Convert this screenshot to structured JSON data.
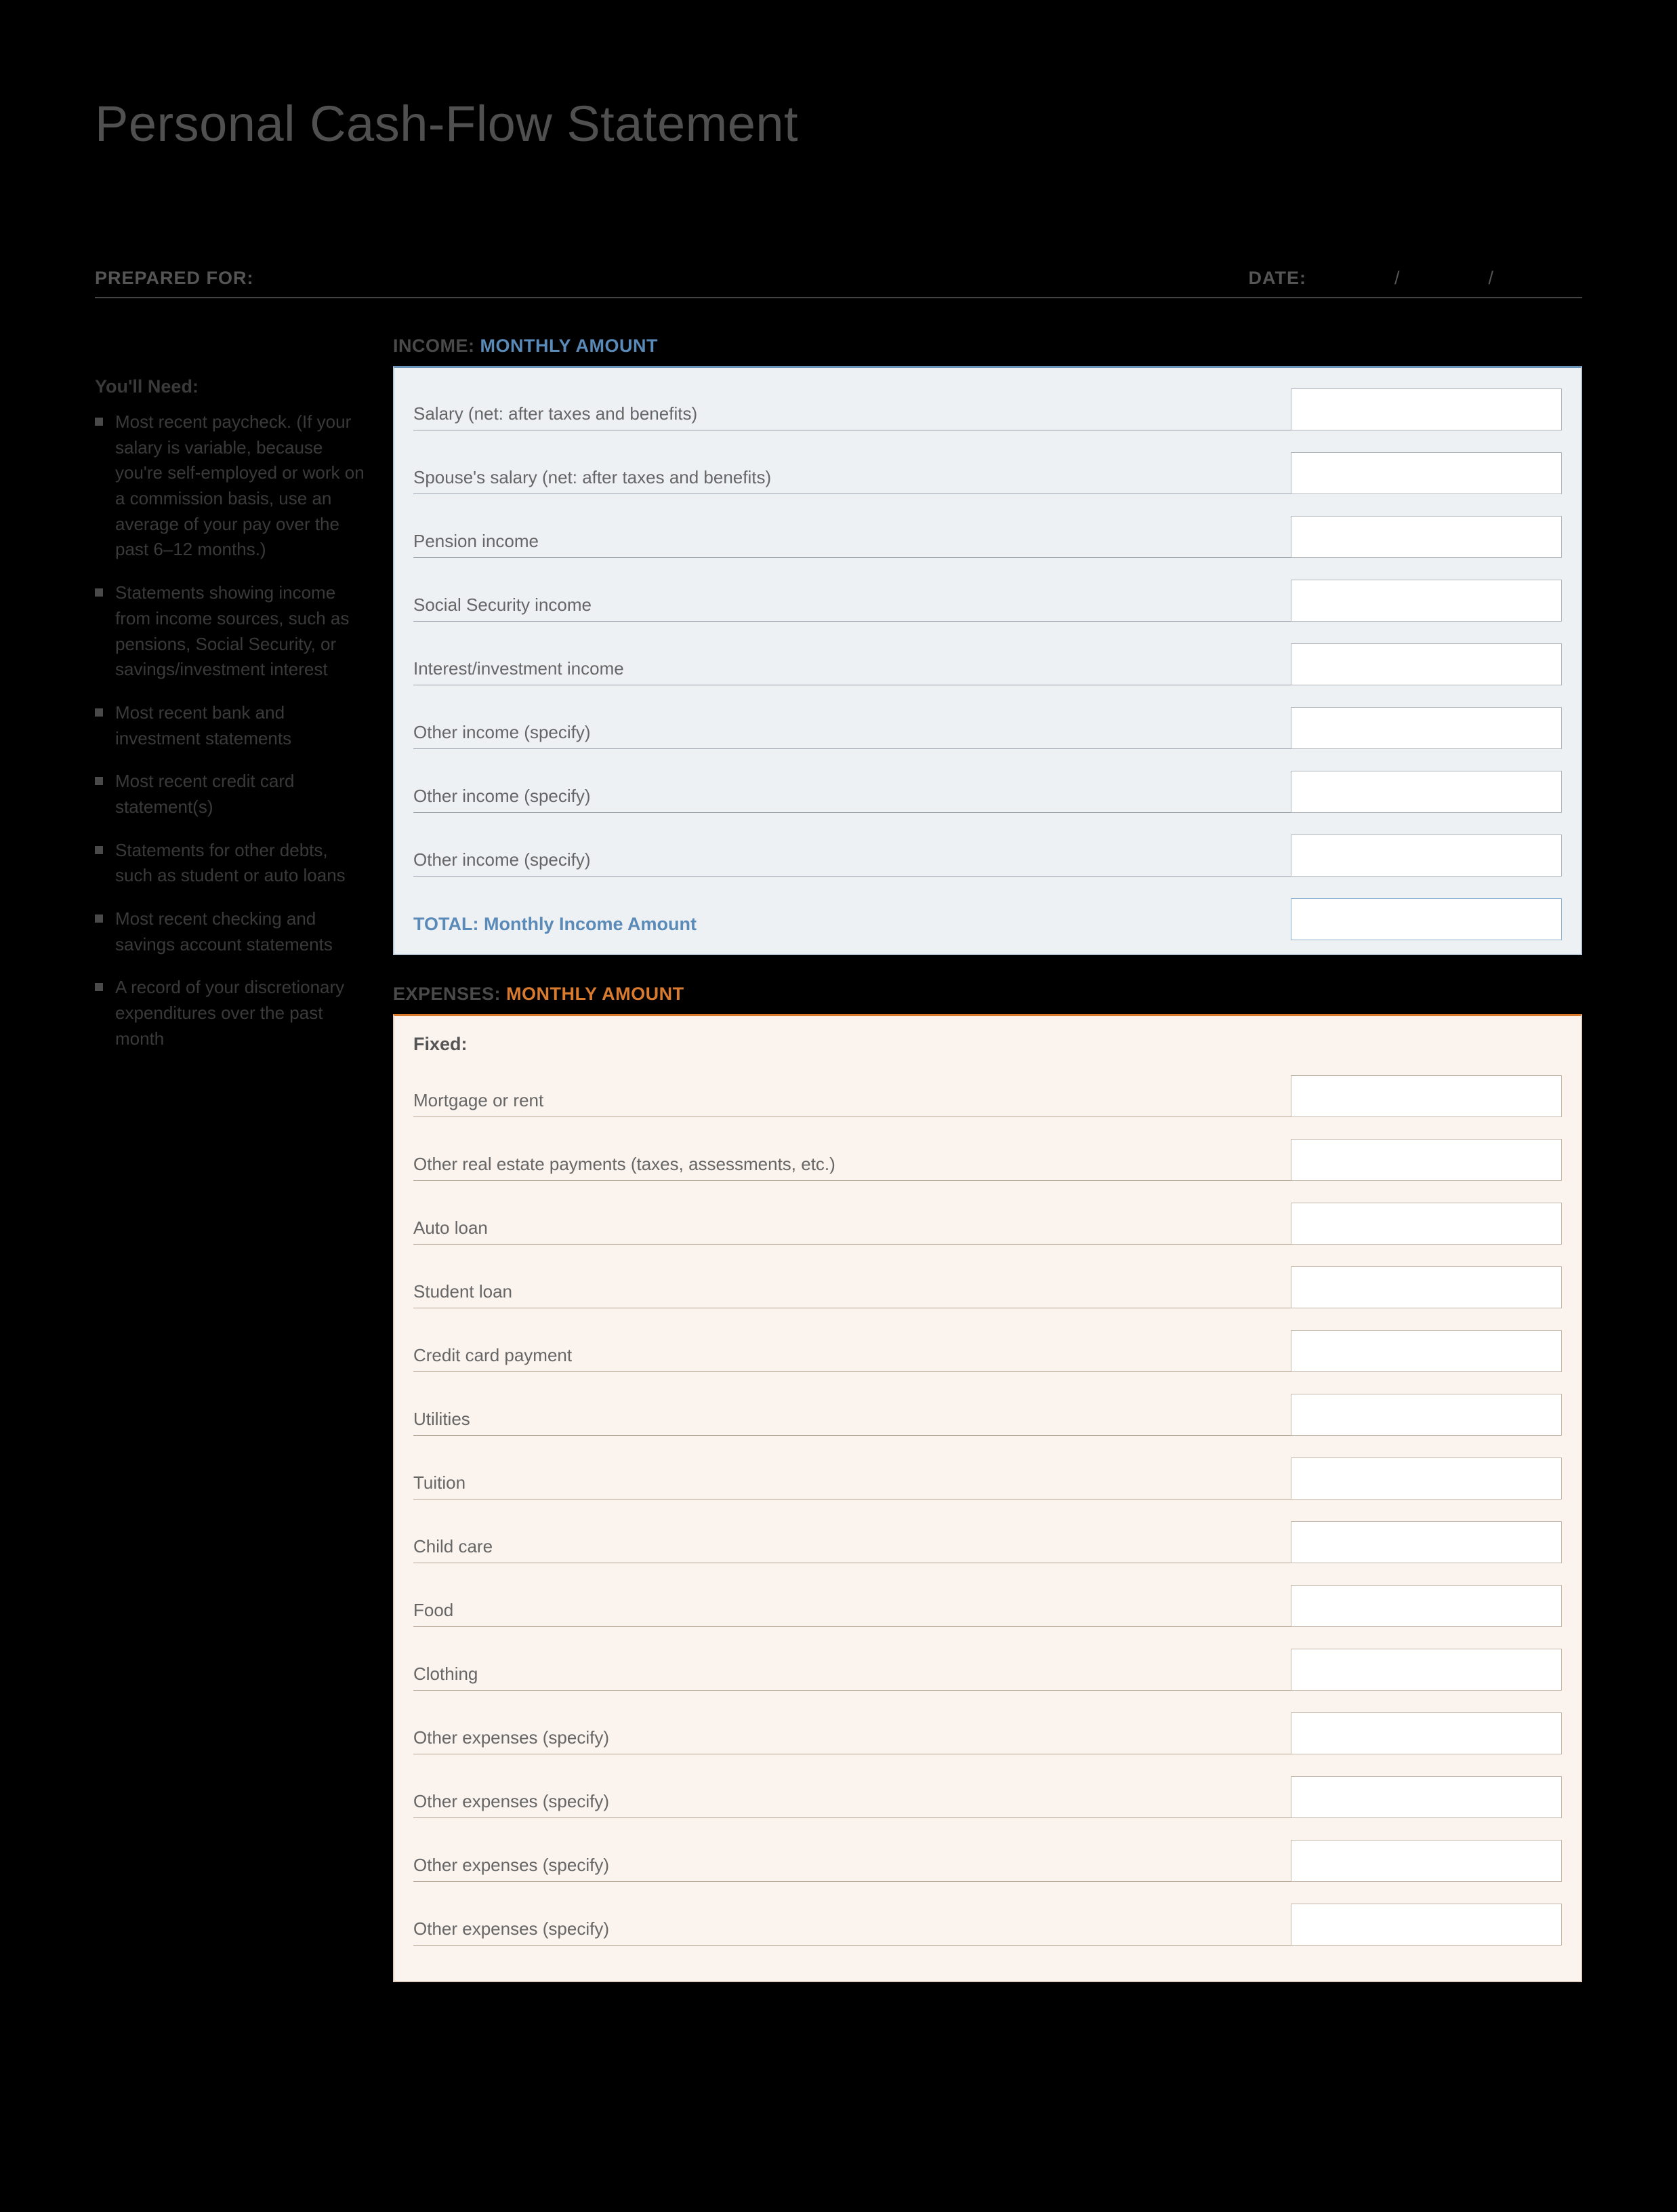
{
  "title": "Personal Cash-Flow Statement",
  "header": {
    "prepared_for_label": "PREPARED FOR:",
    "date_label": "DATE:",
    "slash": "/"
  },
  "sidebar": {
    "heading": "You'll Need:",
    "items": [
      "Most recent paycheck. (If your salary is variable, because you're self-employed or work on a commission basis, use an average of your pay over the past 6–12 months.)",
      "Statements showing income from income sources, such as pensions, Social Security, or savings/investment interest",
      "Most recent bank and investment statements",
      "Most recent credit card statement(s)",
      "Statements for other debts, such as student or auto loans",
      "Most recent checking and savings account statements",
      "A record of your discretionary expenditures over the past month"
    ]
  },
  "income": {
    "section_label_plain": "INCOME:",
    "section_label_accent": " MONTHLY AMOUNT",
    "rows": [
      "Salary (net: after taxes and benefits)",
      "Spouse's salary (net: after taxes and benefits)",
      "Pension income",
      "Social Security income",
      "Interest/investment income",
      "Other income (specify)",
      "Other income (specify)",
      "Other income (specify)"
    ],
    "total_label": "TOTAL: Monthly Income Amount"
  },
  "expenses": {
    "section_label_plain": "EXPENSES:",
    "section_label_accent": " MONTHLY AMOUNT",
    "fixed_label": "Fixed:",
    "rows": [
      "Mortgage or rent",
      "Other real estate payments (taxes, assessments, etc.)",
      "Auto loan",
      "Student loan",
      "Credit card payment",
      "Utilities",
      "Tuition",
      "Child care",
      "Food",
      "Clothing",
      "Other expenses (specify)",
      "Other expenses (specify)",
      "Other expenses (specify)",
      "Other expenses (specify)"
    ]
  }
}
